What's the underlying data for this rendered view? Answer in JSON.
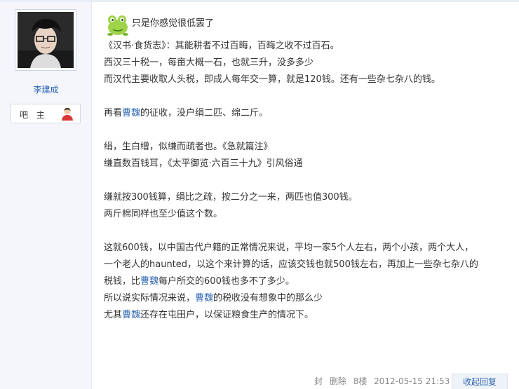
{
  "user": {
    "name": "李建成",
    "badge_label": "吧 主"
  },
  "post": {
    "title_line": "只是你感觉很低罢了",
    "lines": [
      "《汉书·食货志》：其能耕者不过百畮，百畮之收不过百石。",
      "西汉三十税一，每亩大概一石，也就三升，没多多少",
      "而汉代主要收取人头税，即成人每年交一算，就是120钱。还有一些杂七杂八的钱。"
    ],
    "p2_pre": "再看",
    "link": "曹魏",
    "p2_post": "的征收，没户绢二匹、绵二斤。",
    "p3_l1": "绢，生白缯，似缣而疏者也。《急就篇注》",
    "p3_l2": "缣直数百钱耳，《太平御览·六百三十九》引风俗通",
    "p4_l1": "缣就按300钱算，绢比之疏，按二分之一来，两匹也值300钱。",
    "p4_l2": "两斤棉同样也至少值这个数。",
    "p5_l1": "这就600钱，以中国古代户籍的正常情况来说，平均一家5个人左右，两个小孩，两个大人，",
    "p5_l2": "一个老人的haunted，以这个来计算的话，应该交钱也就500钱左右，再加上一些杂七杂八的",
    "p5_l3_pre": "税钱，比",
    "p5_l3_post": "每户所交的600钱也多不了多少。",
    "p5_l4_pre": "所以说实际情况来说，",
    "p5_l4_post": "的税收没有想象中的那么少",
    "p5_l5_pre": "尤其",
    "p5_l5_post": "还存在屯田户，以保证粮食生产的情况下。"
  },
  "footer": {
    "block": "封",
    "delete": "删除",
    "floor": "8楼",
    "datetime": "2012-05-15 21:53",
    "reply": "收起回复"
  },
  "colors": {
    "link": "#2d64b3",
    "sidebar_bg": "#f4f6fb"
  }
}
